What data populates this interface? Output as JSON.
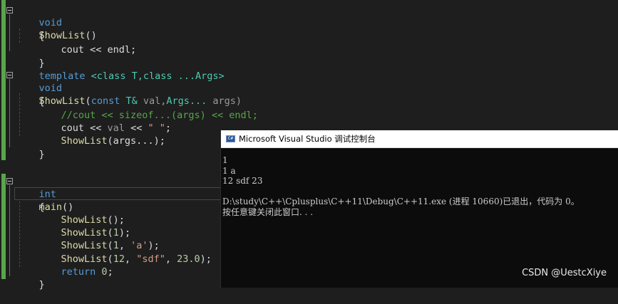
{
  "editor": {
    "lines": {
      "l1": {
        "kw": "void",
        "name": "ShowList",
        "rest": "()"
      },
      "l2": "{",
      "l3": {
        "id": "cout",
        "rest": " << endl;"
      },
      "l4": "}",
      "l5": {
        "kw": "template",
        "rest": " <class T,class ...Args>"
      },
      "l6": {
        "kw": "void",
        "name": "ShowList",
        "a": "(",
        "kw2": "const",
        "t": " T&",
        "b": " val,",
        "t2": "Args...",
        "c": " args)"
      },
      "l7": "{",
      "l8": "//cout << sizeof...(args) << endl;",
      "l9": {
        "id": "cout",
        "a": " << ",
        "v": "val",
        "b": " << ",
        "s": "\" \"",
        "c": ";"
      },
      "l10": {
        "name": "ShowList",
        "rest": "(args...);"
      },
      "l11": "}",
      "l12": {
        "kw": "int",
        "name": "main",
        "rest": "()"
      },
      "l13": "{",
      "l14": {
        "name": "ShowList",
        "rest": "();"
      },
      "l15": {
        "name": "ShowList",
        "a": "(",
        "n": "1",
        "b": ");"
      },
      "l16": {
        "name": "ShowList",
        "a": "(",
        "n": "1",
        "b": ", ",
        "s": "'a'",
        "c": ");"
      },
      "l17": {
        "name": "ShowList",
        "a": "(",
        "n": "12",
        "b": ", ",
        "s": "\"sdf\"",
        "c": ", ",
        "n2": "23.0",
        "d": ");"
      },
      "l18": {
        "kw": "return",
        "n": " 0",
        "rest": ";"
      },
      "l19": "}"
    }
  },
  "console": {
    "title": "Microsoft Visual Studio 调试控制台",
    "icon_label": "C#",
    "lines": [
      "1",
      "1 a",
      "12 sdf 23",
      "",
      "D:\\study\\C++\\Cplusplus\\C++11\\Debug\\C++11.exe (进程 10660)已退出，代码为 0。",
      "按任意键关闭此窗口. . ."
    ]
  },
  "watermark": "CSDN @UestcXiye",
  "colors": {
    "editor_bg": "#1e1e1e",
    "keyword": "#569cd6",
    "function": "#dcdcaa",
    "comment": "#57a64a",
    "string": "#d69d85",
    "console_bg": "#0c0c0c"
  }
}
